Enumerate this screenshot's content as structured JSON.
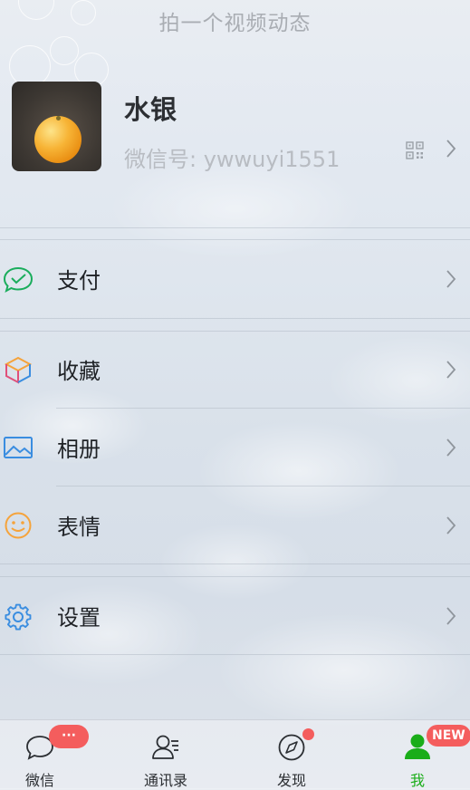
{
  "header": {
    "hint": "拍一个视频动态"
  },
  "profile": {
    "name": "水银",
    "wxid_label": "微信号: ",
    "wxid": "ywwuyi1551",
    "qr_icon": "qr-code-icon"
  },
  "menu": [
    {
      "label": "支付",
      "icon": "pay-icon",
      "color": "#1aad5c"
    },
    {
      "label": "收藏",
      "icon": "favorites-cube-icon",
      "color": "#f5a33b"
    },
    {
      "label": "相册",
      "icon": "album-icon",
      "color": "#3a8de0"
    },
    {
      "label": "表情",
      "icon": "emoji-smile-icon",
      "color": "#f5a33b"
    },
    {
      "label": "设置",
      "icon": "settings-gear-icon",
      "color": "#3a8de0"
    }
  ],
  "tabbar": {
    "tabs": [
      {
        "label": "微信",
        "icon": "chat-bubble-icon",
        "badge": "···"
      },
      {
        "label": "通讯录",
        "icon": "contacts-icon"
      },
      {
        "label": "发现",
        "icon": "discover-compass-icon",
        "badge": "dot"
      },
      {
        "label": "我",
        "icon": "me-person-icon",
        "badge": "NEW",
        "active": true
      }
    ],
    "active_color": "#1aad19"
  }
}
